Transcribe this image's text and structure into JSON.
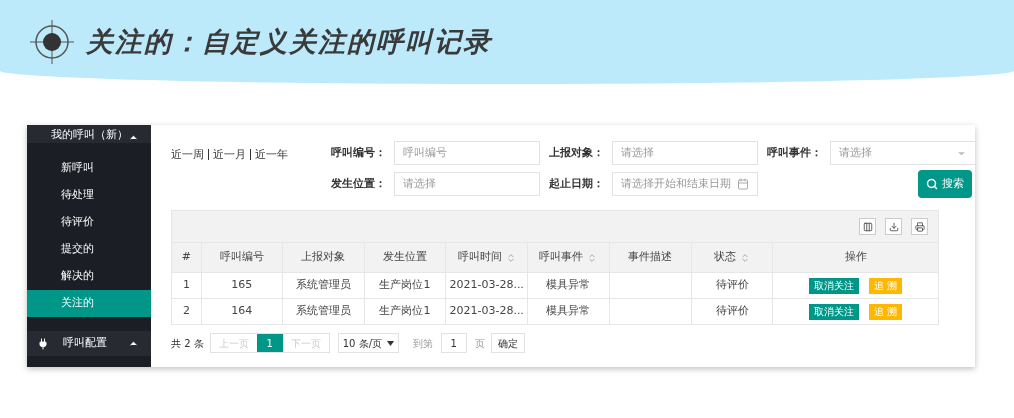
{
  "title": "关注的：自定义关注的呼叫记录",
  "sidebar": {
    "groups": [
      {
        "label": "我的呼叫（新）",
        "items": [
          {
            "label": "新呼叫",
            "selected": false
          },
          {
            "label": "待处理",
            "selected": false
          },
          {
            "label": "待评价",
            "selected": false
          },
          {
            "label": "提交的",
            "selected": false
          },
          {
            "label": "解决的",
            "selected": false
          },
          {
            "label": "关注的",
            "selected": true
          }
        ]
      },
      {
        "label": "呼叫配置"
      }
    ]
  },
  "quick_ranges": [
    "近一周",
    "近一月",
    "近一年"
  ],
  "filters": [
    {
      "label": "呼叫编号：",
      "placeholder": "呼叫编号",
      "kind": "text"
    },
    {
      "label": "上报对象：",
      "placeholder": "请选择",
      "kind": "text"
    },
    {
      "label": "呼叫事件：",
      "placeholder": "请选择",
      "kind": "select"
    },
    {
      "label": "发生位置：",
      "placeholder": "请选择",
      "kind": "text"
    },
    {
      "label": "起止日期：",
      "placeholder": "请选择开始和结束日期",
      "kind": "date"
    }
  ],
  "search_button": "搜索",
  "table": {
    "columns": [
      {
        "label": "#",
        "sortable": false
      },
      {
        "label": "呼叫编号",
        "sortable": false
      },
      {
        "label": "上报对象",
        "sortable": false
      },
      {
        "label": "发生位置",
        "sortable": false
      },
      {
        "label": "呼叫时间",
        "sortable": true
      },
      {
        "label": "呼叫事件",
        "sortable": true
      },
      {
        "label": "事件描述",
        "sortable": false
      },
      {
        "label": "状态",
        "sortable": true
      },
      {
        "label": "操作",
        "sortable": false
      }
    ],
    "rows": [
      {
        "cells": [
          "1",
          "165",
          "系统管理员",
          "生产岗位1",
          "2021-03-28...",
          "模具异常",
          "",
          "待评价"
        ],
        "actions": [
          "取消关注",
          "追 溯"
        ]
      },
      {
        "cells": [
          "2",
          "164",
          "系统管理员",
          "生产岗位1",
          "2021-03-28...",
          "模具异常",
          "",
          "待评价"
        ],
        "actions": [
          "取消关注",
          "追 溯"
        ]
      }
    ]
  },
  "pagination": {
    "total": "共 2 条",
    "prev": "上一页",
    "pages": [
      {
        "label": "1",
        "selected": true
      }
    ],
    "next": "下一页",
    "page_size": "10 条/页",
    "goto_label": "到第",
    "goto_value": "1",
    "page_unit": "页",
    "confirm": "确定"
  }
}
